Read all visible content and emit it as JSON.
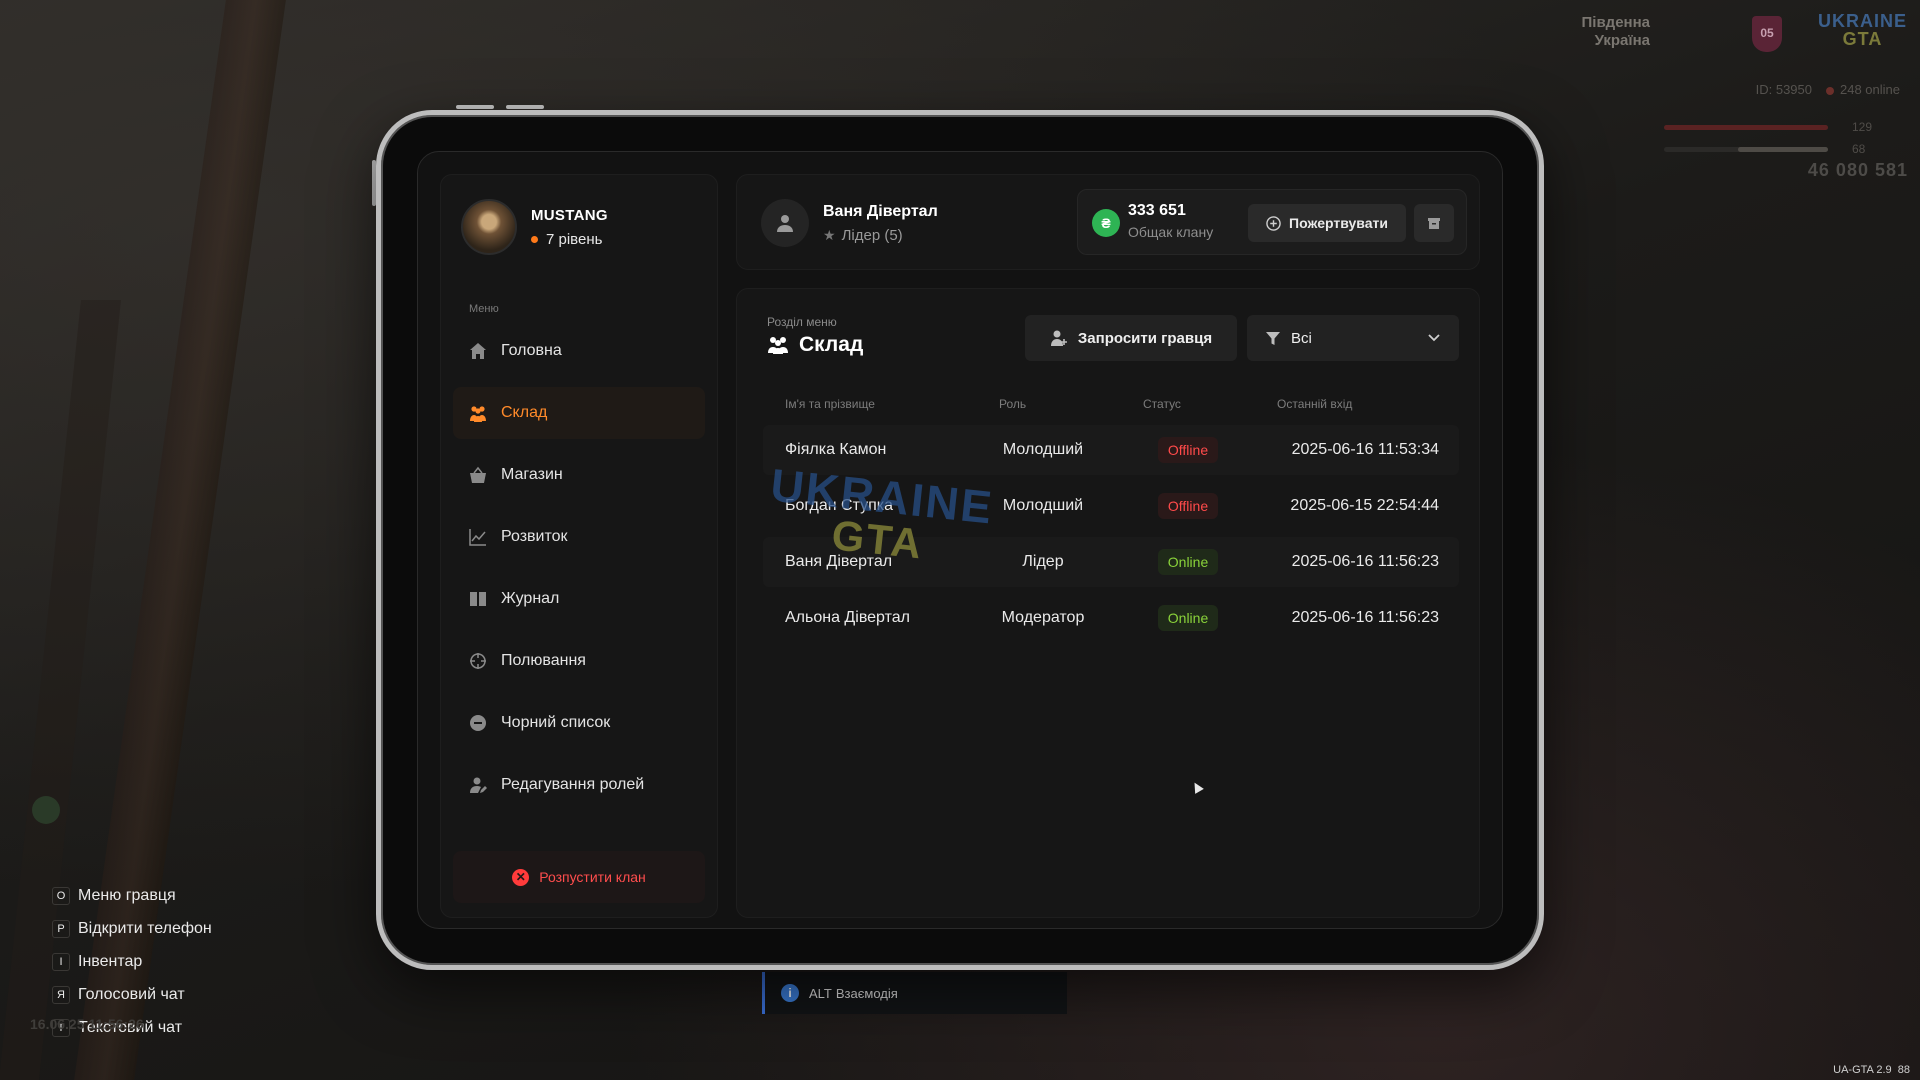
{
  "hud": {
    "region_line1": "Південна",
    "region_line2": "Україна",
    "region_badge": "05",
    "logo_line1": "UKRAINE",
    "logo_line2": "GTA",
    "player_id": "ID: 53950",
    "online": "248 online",
    "health": "129",
    "armor": "68",
    "health_level": 1.0,
    "armor_level": 0.55,
    "money": "46 080 581",
    "hotkeys": [
      {
        "key": "O",
        "label": "Меню гравця"
      },
      {
        "key": "P",
        "label": "Відкрити телефон"
      },
      {
        "key": "I",
        "label": "Інвентар"
      },
      {
        "key": "Я",
        "label": "Голосовий чат"
      },
      {
        "key": "T",
        "label": "Текстовий чат"
      }
    ],
    "datetime": "16.06.25 11:56:26",
    "version": "UA-GTA 2.9",
    "fps": "88",
    "hint_key": "ALT",
    "hint_label": "Взаємодія"
  },
  "clan": {
    "name": "MUSTANG",
    "level": "7 рівень"
  },
  "menu": {
    "title": "Меню",
    "items": [
      {
        "label": "Головна",
        "icon": "home-icon",
        "active": false
      },
      {
        "label": "Склад",
        "icon": "members-icon",
        "active": true
      },
      {
        "label": "Магазин",
        "icon": "basket-icon",
        "active": false
      },
      {
        "label": "Розвиток",
        "icon": "chart-icon",
        "active": false
      },
      {
        "label": "Журнал",
        "icon": "book-icon",
        "active": false
      },
      {
        "label": "Полювання",
        "icon": "crosshair-icon",
        "active": false
      },
      {
        "label": "Чорний список",
        "icon": "minus-circle-icon",
        "active": false
      },
      {
        "label": "Редагування ролей",
        "icon": "user-edit-icon",
        "active": false
      }
    ],
    "dissolve_label": "Розпустити клан"
  },
  "header": {
    "user_name": "Ваня Дівертал",
    "user_role": "Лідер (5)",
    "bank_amount": "333 651",
    "bank_label": "Общак клану",
    "donate_label": "Пожертвувати",
    "currency_symbol": "₴"
  },
  "section": {
    "subtitle": "Розділ меню",
    "title": "Склад",
    "invite_label": "Запросити гравця",
    "filter_value": "Всі"
  },
  "table": {
    "columns": [
      "Ім'я та прізвище",
      "Роль",
      "Статус",
      "Останній вхід"
    ],
    "rows": [
      {
        "name": "Фіялка Камон",
        "role": "Молодший",
        "status": "Offline",
        "last": "2025-06-16 11:53:34"
      },
      {
        "name": "Богдан Ступка",
        "role": "Молодший",
        "status": "Offline",
        "last": "2025-06-15 22:54:44"
      },
      {
        "name": "Ваня Дівертал",
        "role": "Лідер",
        "status": "Online",
        "last": "2025-06-16 11:56:23"
      },
      {
        "name": "Альона Дівертал",
        "role": "Модератор",
        "status": "Online",
        "last": "2025-06-16 11:56:23"
      }
    ]
  },
  "watermark": {
    "line1": "UKRAINE",
    "line2": "GTA"
  },
  "colors": {
    "accent": "#ff8a2a",
    "online": "#8ad33a",
    "offline": "#ff4a4a",
    "bank": "#2eb454",
    "danger": "#ff3b3b"
  }
}
